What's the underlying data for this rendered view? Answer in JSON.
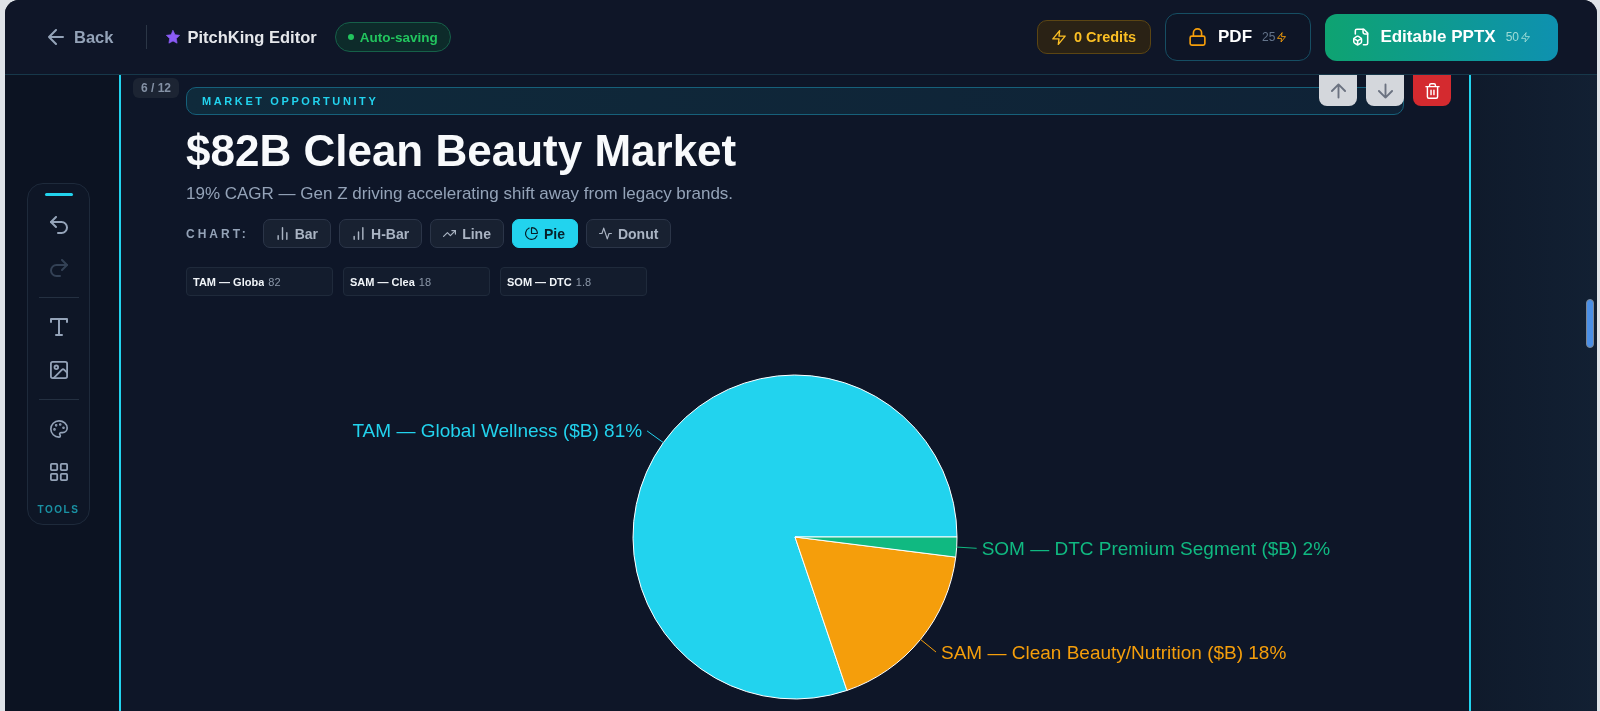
{
  "header": {
    "back": "Back",
    "app_title": "PitchKing Editor",
    "save_status": "Auto-saving",
    "credits": "0 Credits",
    "exports": [
      {
        "kind": "outline",
        "label": "PDF",
        "cost": "25"
      },
      {
        "kind": "primary",
        "label": "Editable PPTX",
        "cost": "50"
      }
    ]
  },
  "tool_panel": {
    "groups": [
      {
        "tools": [
          {
            "kind": "undo",
            "disabled": false
          },
          {
            "kind": "redo",
            "disabled": true
          }
        ]
      },
      {
        "tools": [
          {
            "kind": "text",
            "disabled": false
          },
          {
            "kind": "image",
            "disabled": false
          }
        ]
      },
      {
        "tools": [
          {
            "kind": "palette",
            "disabled": false
          },
          {
            "kind": "layout",
            "disabled": false
          }
        ]
      }
    ],
    "label": "TOOLS"
  },
  "slide": {
    "counter": "6 / 12",
    "actions": [
      {
        "kind": "move_up"
      },
      {
        "kind": "move_down"
      },
      {
        "kind": "delete"
      }
    ],
    "section_label": "MARKET OPPORTUNITY",
    "title": "$82B Clean Beauty Market",
    "subtitle": "19% CAGR — Gen Z driving accelerating shift away from legacy brands.",
    "chart_picker": {
      "label": "CHART:",
      "types": [
        {
          "kind": "bar",
          "label": "Bar",
          "selected": false
        },
        {
          "kind": "hbar",
          "label": "H-Bar",
          "selected": false
        },
        {
          "kind": "line",
          "label": "Line",
          "selected": false
        },
        {
          "kind": "pie",
          "label": "Pie",
          "selected": true
        },
        {
          "kind": "donut",
          "label": "Donut",
          "selected": false
        }
      ]
    },
    "series_entries": [
      {
        "label": "TAM — Globa",
        "value": "82"
      },
      {
        "label": "SAM — Clea",
        "value": "18"
      },
      {
        "label": "SOM — DTC",
        "value": "1.8"
      }
    ],
    "chart_data": {
      "type": "pie",
      "categories": [
        "TAM — Global Wellness ($B)",
        "SAM — Clean Beauty/Nutrition ($B)",
        "SOM — DTC Premium Segment ($B)"
      ],
      "values": [
        81,
        18,
        2
      ],
      "value_labels": [
        "81%",
        "18%",
        "2%"
      ]
    }
  }
}
